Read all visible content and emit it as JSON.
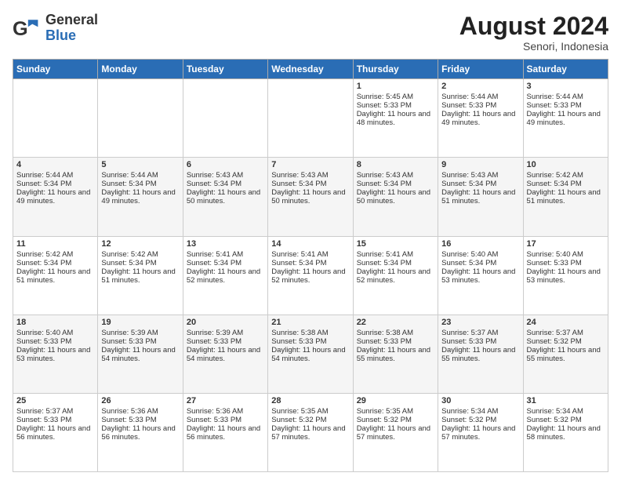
{
  "logo": {
    "general": "General",
    "blue": "Blue"
  },
  "title": {
    "month_year": "August 2024",
    "location": "Senori, Indonesia"
  },
  "days_of_week": [
    "Sunday",
    "Monday",
    "Tuesday",
    "Wednesday",
    "Thursday",
    "Friday",
    "Saturday"
  ],
  "weeks": [
    [
      {
        "day": "",
        "sunrise": "",
        "sunset": "",
        "daylight": ""
      },
      {
        "day": "",
        "sunrise": "",
        "sunset": "",
        "daylight": ""
      },
      {
        "day": "",
        "sunrise": "",
        "sunset": "",
        "daylight": ""
      },
      {
        "day": "",
        "sunrise": "",
        "sunset": "",
        "daylight": ""
      },
      {
        "day": "1",
        "sunrise": "Sunrise: 5:45 AM",
        "sunset": "Sunset: 5:33 PM",
        "daylight": "Daylight: 11 hours and 48 minutes."
      },
      {
        "day": "2",
        "sunrise": "Sunrise: 5:44 AM",
        "sunset": "Sunset: 5:33 PM",
        "daylight": "Daylight: 11 hours and 49 minutes."
      },
      {
        "day": "3",
        "sunrise": "Sunrise: 5:44 AM",
        "sunset": "Sunset: 5:33 PM",
        "daylight": "Daylight: 11 hours and 49 minutes."
      }
    ],
    [
      {
        "day": "4",
        "sunrise": "Sunrise: 5:44 AM",
        "sunset": "Sunset: 5:34 PM",
        "daylight": "Daylight: 11 hours and 49 minutes."
      },
      {
        "day": "5",
        "sunrise": "Sunrise: 5:44 AM",
        "sunset": "Sunset: 5:34 PM",
        "daylight": "Daylight: 11 hours and 49 minutes."
      },
      {
        "day": "6",
        "sunrise": "Sunrise: 5:43 AM",
        "sunset": "Sunset: 5:34 PM",
        "daylight": "Daylight: 11 hours and 50 minutes."
      },
      {
        "day": "7",
        "sunrise": "Sunrise: 5:43 AM",
        "sunset": "Sunset: 5:34 PM",
        "daylight": "Daylight: 11 hours and 50 minutes."
      },
      {
        "day": "8",
        "sunrise": "Sunrise: 5:43 AM",
        "sunset": "Sunset: 5:34 PM",
        "daylight": "Daylight: 11 hours and 50 minutes."
      },
      {
        "day": "9",
        "sunrise": "Sunrise: 5:43 AM",
        "sunset": "Sunset: 5:34 PM",
        "daylight": "Daylight: 11 hours and 51 minutes."
      },
      {
        "day": "10",
        "sunrise": "Sunrise: 5:42 AM",
        "sunset": "Sunset: 5:34 PM",
        "daylight": "Daylight: 11 hours and 51 minutes."
      }
    ],
    [
      {
        "day": "11",
        "sunrise": "Sunrise: 5:42 AM",
        "sunset": "Sunset: 5:34 PM",
        "daylight": "Daylight: 11 hours and 51 minutes."
      },
      {
        "day": "12",
        "sunrise": "Sunrise: 5:42 AM",
        "sunset": "Sunset: 5:34 PM",
        "daylight": "Daylight: 11 hours and 51 minutes."
      },
      {
        "day": "13",
        "sunrise": "Sunrise: 5:41 AM",
        "sunset": "Sunset: 5:34 PM",
        "daylight": "Daylight: 11 hours and 52 minutes."
      },
      {
        "day": "14",
        "sunrise": "Sunrise: 5:41 AM",
        "sunset": "Sunset: 5:34 PM",
        "daylight": "Daylight: 11 hours and 52 minutes."
      },
      {
        "day": "15",
        "sunrise": "Sunrise: 5:41 AM",
        "sunset": "Sunset: 5:34 PM",
        "daylight": "Daylight: 11 hours and 52 minutes."
      },
      {
        "day": "16",
        "sunrise": "Sunrise: 5:40 AM",
        "sunset": "Sunset: 5:34 PM",
        "daylight": "Daylight: 11 hours and 53 minutes."
      },
      {
        "day": "17",
        "sunrise": "Sunrise: 5:40 AM",
        "sunset": "Sunset: 5:33 PM",
        "daylight": "Daylight: 11 hours and 53 minutes."
      }
    ],
    [
      {
        "day": "18",
        "sunrise": "Sunrise: 5:40 AM",
        "sunset": "Sunset: 5:33 PM",
        "daylight": "Daylight: 11 hours and 53 minutes."
      },
      {
        "day": "19",
        "sunrise": "Sunrise: 5:39 AM",
        "sunset": "Sunset: 5:33 PM",
        "daylight": "Daylight: 11 hours and 54 minutes."
      },
      {
        "day": "20",
        "sunrise": "Sunrise: 5:39 AM",
        "sunset": "Sunset: 5:33 PM",
        "daylight": "Daylight: 11 hours and 54 minutes."
      },
      {
        "day": "21",
        "sunrise": "Sunrise: 5:38 AM",
        "sunset": "Sunset: 5:33 PM",
        "daylight": "Daylight: 11 hours and 54 minutes."
      },
      {
        "day": "22",
        "sunrise": "Sunrise: 5:38 AM",
        "sunset": "Sunset: 5:33 PM",
        "daylight": "Daylight: 11 hours and 55 minutes."
      },
      {
        "day": "23",
        "sunrise": "Sunrise: 5:37 AM",
        "sunset": "Sunset: 5:33 PM",
        "daylight": "Daylight: 11 hours and 55 minutes."
      },
      {
        "day": "24",
        "sunrise": "Sunrise: 5:37 AM",
        "sunset": "Sunset: 5:32 PM",
        "daylight": "Daylight: 11 hours and 55 minutes."
      }
    ],
    [
      {
        "day": "25",
        "sunrise": "Sunrise: 5:37 AM",
        "sunset": "Sunset: 5:33 PM",
        "daylight": "Daylight: 11 hours and 56 minutes."
      },
      {
        "day": "26",
        "sunrise": "Sunrise: 5:36 AM",
        "sunset": "Sunset: 5:33 PM",
        "daylight": "Daylight: 11 hours and 56 minutes."
      },
      {
        "day": "27",
        "sunrise": "Sunrise: 5:36 AM",
        "sunset": "Sunset: 5:33 PM",
        "daylight": "Daylight: 11 hours and 56 minutes."
      },
      {
        "day": "28",
        "sunrise": "Sunrise: 5:35 AM",
        "sunset": "Sunset: 5:32 PM",
        "daylight": "Daylight: 11 hours and 57 minutes."
      },
      {
        "day": "29",
        "sunrise": "Sunrise: 5:35 AM",
        "sunset": "Sunset: 5:32 PM",
        "daylight": "Daylight: 11 hours and 57 minutes."
      },
      {
        "day": "30",
        "sunrise": "Sunrise: 5:34 AM",
        "sunset": "Sunset: 5:32 PM",
        "daylight": "Daylight: 11 hours and 57 minutes."
      },
      {
        "day": "31",
        "sunrise": "Sunrise: 5:34 AM",
        "sunset": "Sunset: 5:32 PM",
        "daylight": "Daylight: 11 hours and 58 minutes."
      }
    ]
  ]
}
